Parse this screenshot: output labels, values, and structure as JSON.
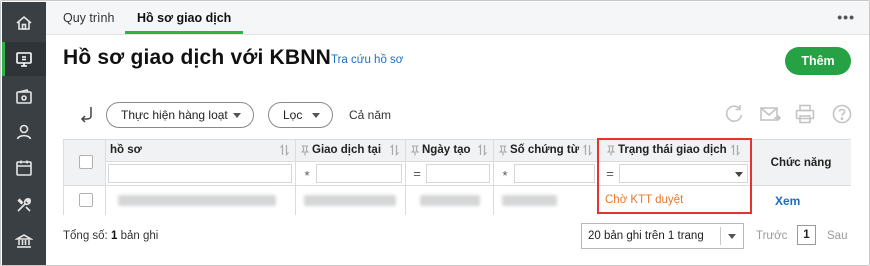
{
  "tabs": [
    {
      "label": "Quy trình",
      "active": false
    },
    {
      "label": "Hồ sơ giao dịch",
      "active": true
    }
  ],
  "tabs_more_icon": "more-horizontal-icon",
  "sidebar": {
    "items": [
      {
        "icon": "home-icon",
        "active": false
      },
      {
        "icon": "monitor-icon",
        "active": true
      },
      {
        "icon": "wallet-icon",
        "active": false
      },
      {
        "icon": "user-icon",
        "active": false
      },
      {
        "icon": "calendar-icon",
        "active": false
      },
      {
        "icon": "tools-icon",
        "active": false
      },
      {
        "icon": "bank-icon",
        "active": false
      }
    ]
  },
  "header": {
    "title": "Hồ sơ giao dịch với KBNN",
    "lookup_link": "Tra cứu hồ sơ",
    "add_button": "Thêm"
  },
  "toolbar": {
    "batch_button": "Thực hiện hàng loạt",
    "filter_button": "Lọc",
    "year_label": "Cả năm",
    "icons": [
      "refresh-icon",
      "mail-icon",
      "print-icon",
      "help-icon"
    ]
  },
  "grid": {
    "columns": [
      {
        "label": "hồ sơ",
        "filter_op": ""
      },
      {
        "label": "Giao dịch tại",
        "filter_op": "*"
      },
      {
        "label": "Ngày tạo",
        "filter_op": "="
      },
      {
        "label": "Số chứng từ",
        "filter_op": "*"
      },
      {
        "label": "Trạng thái giao dịch",
        "filter_op": "="
      }
    ],
    "action_column": "Chức năng",
    "rows": [
      {
        "status": "Chờ KTT duyệt",
        "action": "Xem"
      }
    ]
  },
  "footer": {
    "total_prefix": "Tổng số:",
    "total_count": "1",
    "total_suffix": "bản ghi",
    "page_size_label": "20 bản ghi trên 1 trang",
    "prev_label": "Trước",
    "current_page": "1",
    "next_label": "Sau"
  },
  "colors": {
    "accent": "#26a143",
    "status_pending": "#e8792b",
    "link": "#1a6fc4",
    "highlight": "#e3342f"
  }
}
